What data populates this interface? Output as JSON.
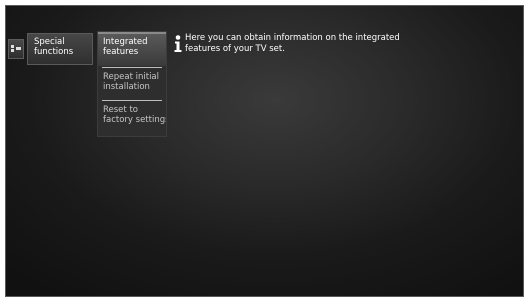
{
  "menu": {
    "icon": "menu-grid-icon",
    "main_item": {
      "line1": "Special",
      "line2": "functions"
    },
    "submenu": [
      {
        "line1": "Integrated",
        "line2": "features",
        "selected": true
      },
      {
        "line1": "Repeat initial",
        "line2": "installation",
        "selected": false
      },
      {
        "line1": "Reset to",
        "line2": "factory settings",
        "selected": false
      }
    ]
  },
  "info": {
    "icon": "info-icon",
    "line1": "Here you can obtain information on the integrated",
    "line2": "features of your TV set."
  },
  "colors": {
    "background": "#1e1e1e",
    "text": "#ffffff",
    "dim_text": "#c6c6c6"
  }
}
